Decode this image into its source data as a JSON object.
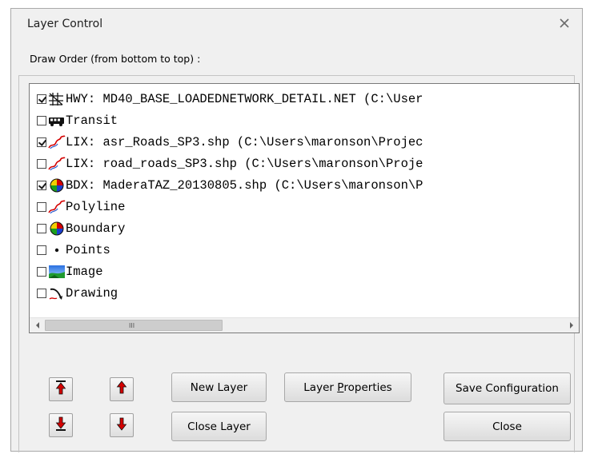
{
  "window": {
    "title": "Layer Control"
  },
  "group": {
    "label": "Draw Order (from bottom to top) :"
  },
  "layers": [
    {
      "checked": true,
      "icon": "network-grid-icon",
      "text": "HWY: MD40_BASE_LOADEDNETWORK_DETAIL.NET (C:\\User"
    },
    {
      "checked": false,
      "icon": "bus-icon",
      "text": "Transit"
    },
    {
      "checked": true,
      "icon": "polyline-icon",
      "text": "LIX: asr_Roads_SP3.shp (C:\\Users\\maronson\\Projec"
    },
    {
      "checked": false,
      "icon": "polyline-icon",
      "text": "LIX: road_roads_SP3.shp (C:\\Users\\maronson\\Proje"
    },
    {
      "checked": true,
      "icon": "boundary-icon",
      "text": "BDX: MaderaTAZ_20130805.shp (C:\\Users\\maronson\\P"
    },
    {
      "checked": false,
      "icon": "polyline-icon",
      "text": "Polyline"
    },
    {
      "checked": false,
      "icon": "boundary-icon",
      "text": "Boundary"
    },
    {
      "checked": false,
      "icon": "point-icon",
      "text": "Points"
    },
    {
      "checked": false,
      "icon": "image-icon",
      "text": "Image"
    },
    {
      "checked": false,
      "icon": "drawing-icon",
      "text": "Drawing"
    }
  ],
  "scrollbar": {
    "grip": "III"
  },
  "buttons": {
    "new_layer": "New Layer",
    "close_layer": "Close Layer",
    "layer_properties_pre": "Layer ",
    "layer_properties_underlined": "P",
    "layer_properties_post": "roperties",
    "save_configuration": "Save Configuration",
    "close": "Close"
  },
  "colors": {
    "arrow_red": "#d40000",
    "window_bg": "#f0f0f0"
  }
}
